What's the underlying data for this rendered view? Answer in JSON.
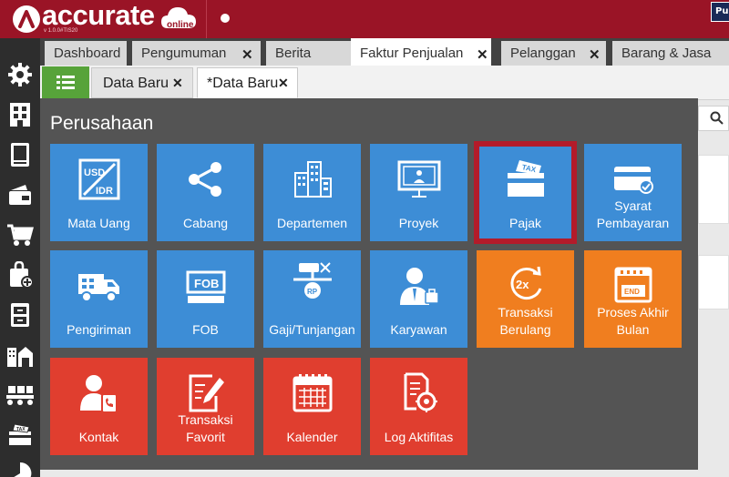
{
  "app": {
    "logo_text": "accurate",
    "logo_suffix": "online",
    "version": "v 1.0.0#TIS20",
    "top_button": "Pu"
  },
  "tabs_row1": [
    {
      "label": "Dashboard"
    },
    {
      "label": "Pengumuman"
    },
    {
      "label": "Berita"
    },
    {
      "label": "Faktur Penjualan"
    },
    {
      "label": "Pelanggan"
    },
    {
      "label": "Barang & Jasa"
    }
  ],
  "tabs_row2": [
    {
      "label": "Data Baru"
    },
    {
      "label": "*Data Baru"
    }
  ],
  "popup": {
    "title": "Perusahaan",
    "tiles": [
      {
        "label": "Mata Uang",
        "icon": "usd-idr-icon",
        "color": "#3d8dd6"
      },
      {
        "label": "Cabang",
        "icon": "share-icon",
        "color": "#3d8dd6"
      },
      {
        "label": "Departemen",
        "icon": "buildings-icon",
        "color": "#3d8dd6"
      },
      {
        "label": "Proyek",
        "icon": "project-board-icon",
        "color": "#3d8dd6"
      },
      {
        "label": "Pajak",
        "icon": "tax-icon",
        "color": "#3d8dd6",
        "selected": true
      },
      {
        "label": "Syarat Pembayaran",
        "icon": "payment-card-icon",
        "color": "#3d8dd6"
      },
      {
        "label": "Pengiriman",
        "icon": "truck-icon",
        "color": "#3d8dd6"
      },
      {
        "label": "FOB",
        "icon": "fob-icon",
        "color": "#3d8dd6"
      },
      {
        "label": "Gaji/Tunjangan",
        "icon": "payroll-icon",
        "color": "#3d8dd6"
      },
      {
        "label": "Karyawan",
        "icon": "employee-icon",
        "color": "#3d8dd6"
      },
      {
        "label": "Transaksi Berulang",
        "icon": "repeat-2x-icon",
        "color": "#f07e1f"
      },
      {
        "label": "Proses Akhir Bulan",
        "icon": "calendar-end-icon",
        "color": "#f07e1f"
      },
      {
        "label": "Kontak",
        "icon": "contact-icon",
        "color": "#e03e2f"
      },
      {
        "label": "Transaksi Favorit",
        "icon": "edit-note-icon",
        "color": "#e03e2f"
      },
      {
        "label": "Kalender",
        "icon": "calendar-icon",
        "color": "#e03e2f"
      },
      {
        "label": "Log Aktifitas",
        "icon": "activity-log-icon",
        "color": "#e03e2f"
      }
    ]
  }
}
